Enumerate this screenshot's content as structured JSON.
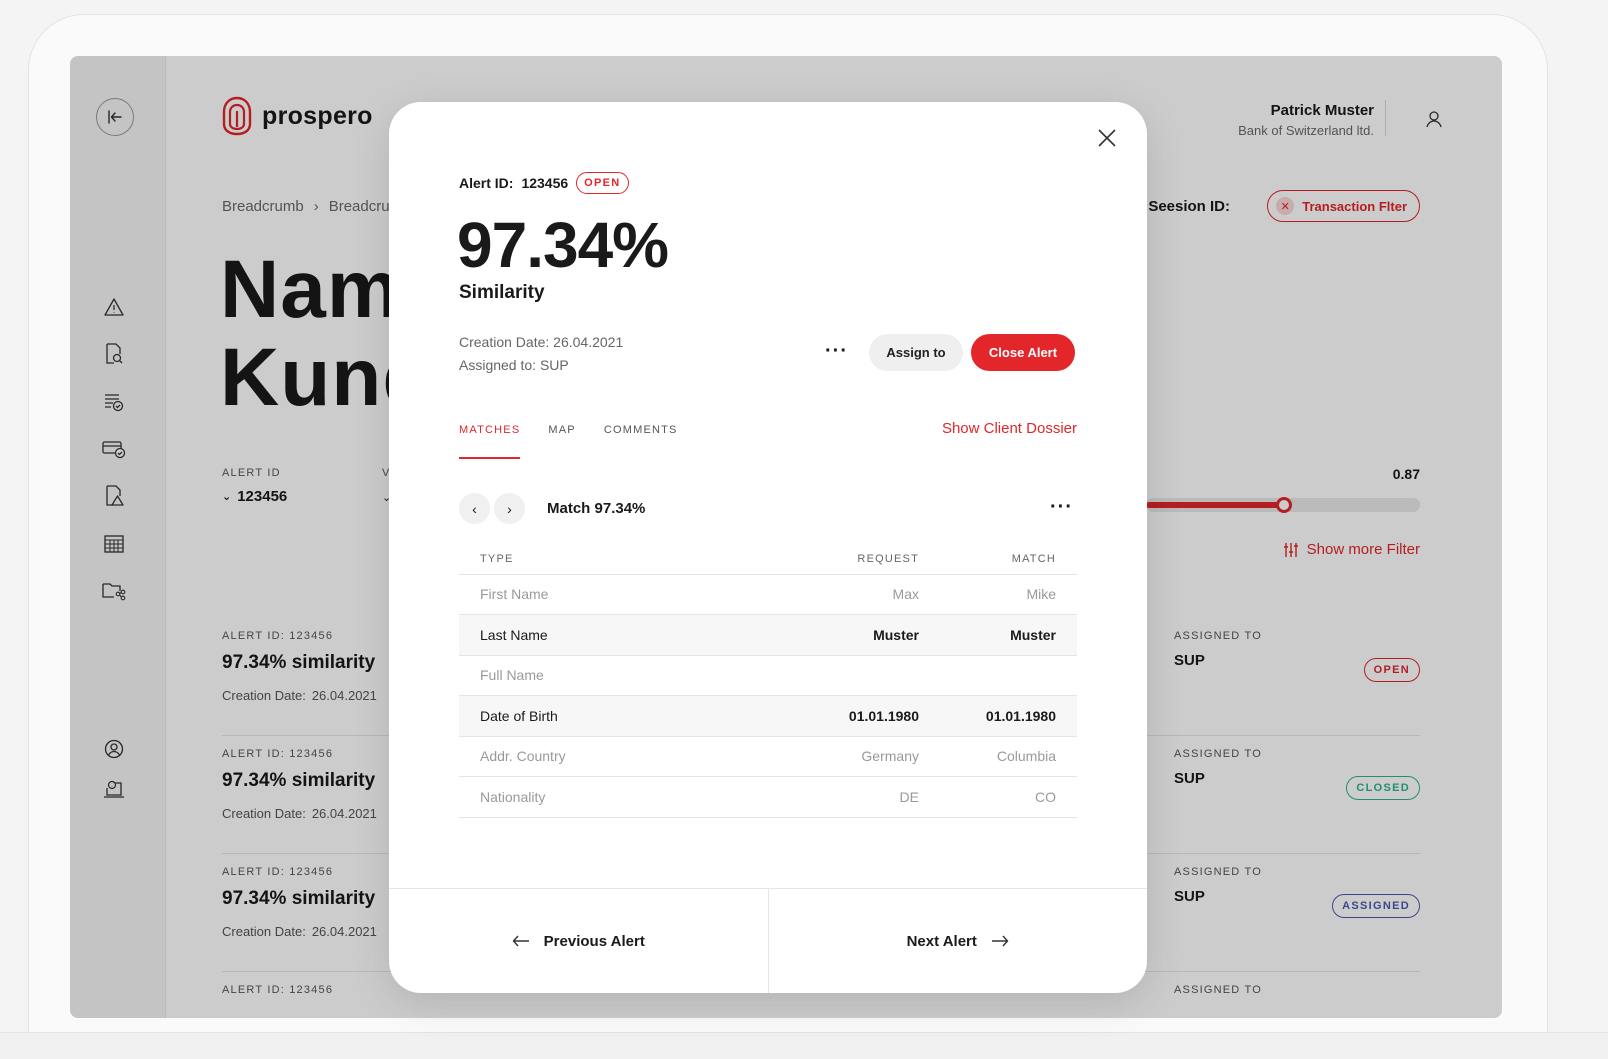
{
  "app": {
    "brand": "prospero",
    "breadcrumb": [
      "Breadcrumb",
      "Breadcrumb"
    ],
    "title_line1": "Name",
    "title_line2": "Kunde",
    "user": {
      "name": "Patrick Muster",
      "org": "Bank of Switzerland ltd."
    },
    "session_label": "Seesion ID:",
    "session_chip": "Transaction Flter",
    "filters": {
      "alert_id_label": "ALERT ID",
      "alert_id_value": "123456",
      "second_label": "V"
    },
    "slider": {
      "value_label": "0.87",
      "value": 0.87
    },
    "show_more_filter": "Show more Filter",
    "rows": [
      {
        "id": "ALERT ID: 123456",
        "similarity": "97.34% similarity",
        "date_label": "Creation Date:",
        "date": "26.04.2021",
        "assigned_label": "ASSIGNED TO",
        "assigned": "SUP",
        "status": "OPEN"
      },
      {
        "id": "ALERT ID: 123456",
        "similarity": "97.34% similarity",
        "date_label": "Creation Date:",
        "date": "26.04.2021",
        "assigned_label": "ASSIGNED TO",
        "assigned": "SUP",
        "status": "CLOSED"
      },
      {
        "id": "ALERT ID: 123456",
        "similarity": "97.34% similarity",
        "date_label": "Creation Date:",
        "date": "26.04.2021",
        "assigned_label": "ASSIGNED TO",
        "assigned": "SUP",
        "status": "ASSIGNED"
      },
      {
        "id": "ALERT ID: 123456",
        "similarity": "",
        "date_label": "",
        "date": "",
        "assigned_label": "ASSIGNED TO",
        "assigned": "",
        "status": ""
      }
    ],
    "colors": {
      "accent": "#e2262a",
      "closed": "#2bb38f",
      "assigned": "#4a5ab0"
    }
  },
  "modal": {
    "alert_id_label": "Alert ID:",
    "alert_id": "123456",
    "status": "OPEN",
    "similarity_pct": "97.34%",
    "similarity_label": "Similarity",
    "creation_date_label": "Creation Date:",
    "creation_date": "26.04.2021",
    "assigned_label": "Assigned to:",
    "assigned": "SUP",
    "more_actions": "···",
    "assign_button": "Assign to",
    "close_alert_button": "Close Alert",
    "tabs": [
      "MATCHES",
      "MAP",
      "COMMENTS"
    ],
    "active_tab": "MATCHES",
    "dossier_link": "Show Client Dossier",
    "match_title": "Match 97.34%",
    "table": {
      "headers": [
        "TYPE",
        "REQUEST",
        "MATCH"
      ],
      "rows": [
        {
          "type": "First Name",
          "request": "Max",
          "match": "Mike",
          "highlight": false
        },
        {
          "type": "Last Name",
          "request": "Muster",
          "match": "Muster",
          "highlight": true
        },
        {
          "type": "Full Name",
          "request": "",
          "match": "",
          "highlight": false
        },
        {
          "type": "Date of Birth",
          "request": "01.01.1980",
          "match": "01.01.1980",
          "highlight": true
        },
        {
          "type": "Addr. Country",
          "request": "Germany",
          "match": "Columbia",
          "highlight": false
        },
        {
          "type": "Nationality",
          "request": "DE",
          "match": "CO",
          "highlight": false
        }
      ]
    },
    "previous_alert": "Previous Alert",
    "next_alert": "Next Alert"
  }
}
